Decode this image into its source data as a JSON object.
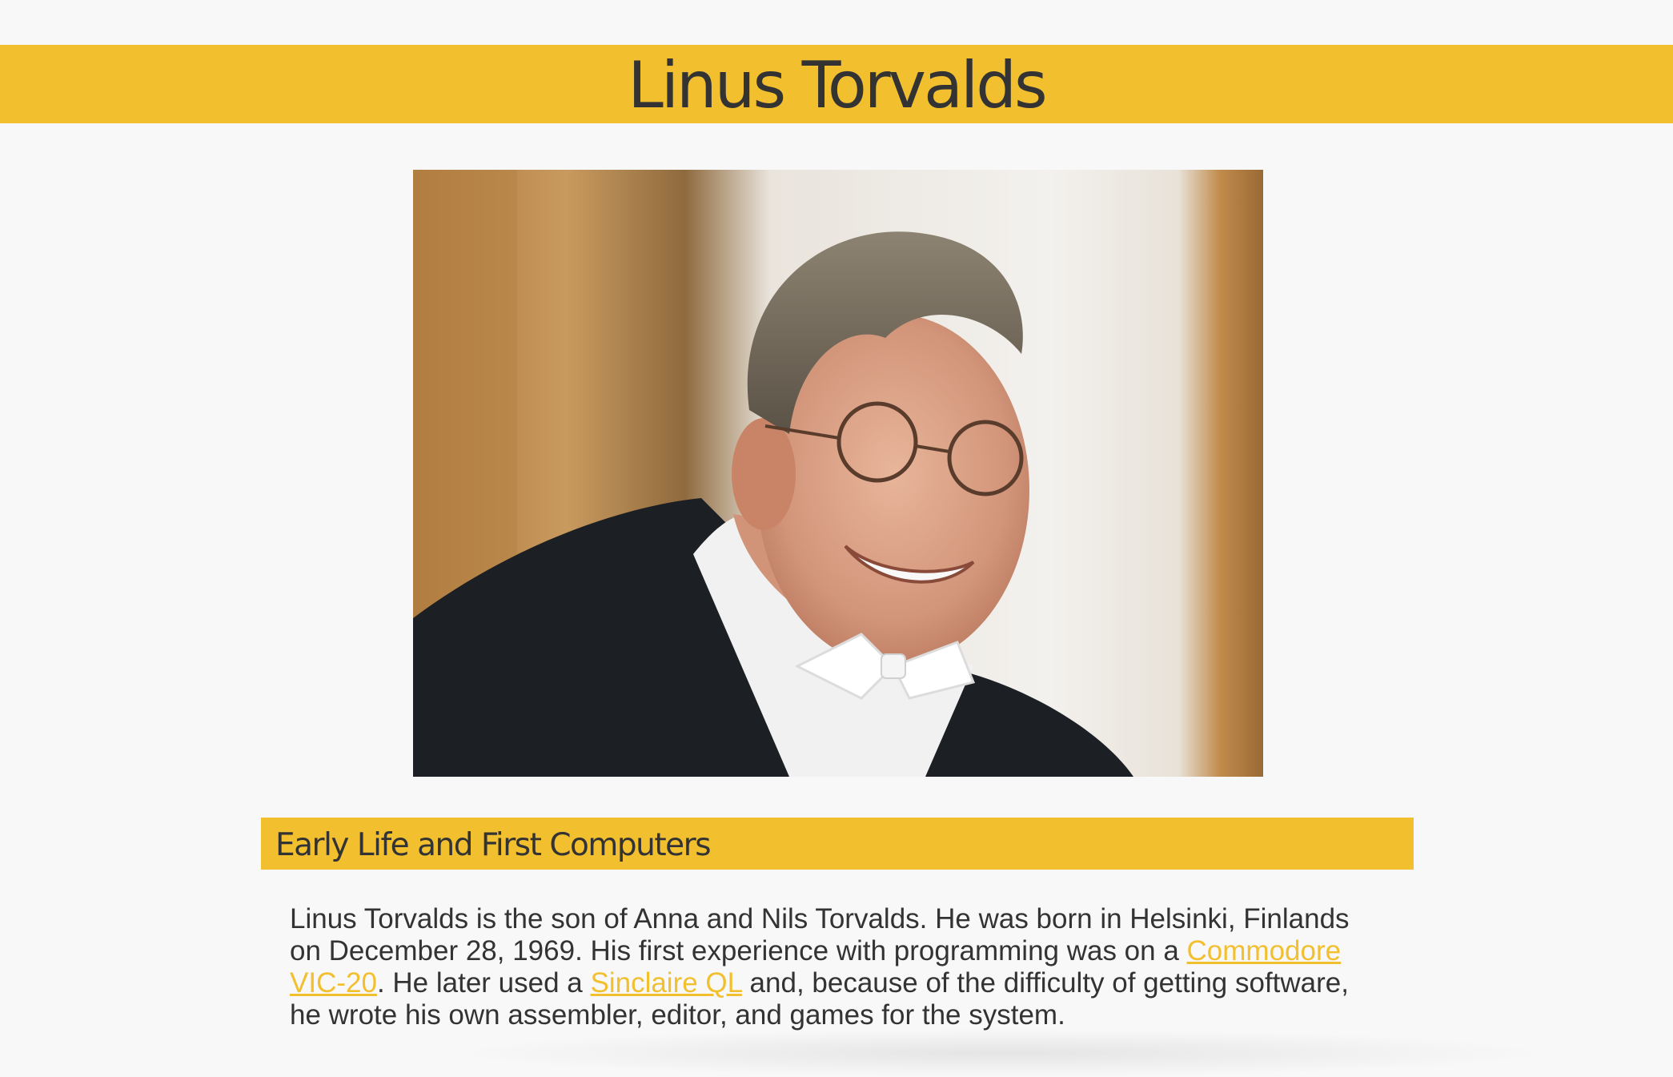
{
  "header": {
    "title": "Linus Torvalds"
  },
  "portrait": {
    "subject": "Smiling man with glasses wearing a black tuxedo and white bow tie",
    "icon": "portrait-photo"
  },
  "section": {
    "heading": "Early Life and First Computers",
    "bio": {
      "part1": "Linus Torvalds is the son of Anna and Nils Torvalds. He was born in Helsinki, Finlands on December 28, 1969. His first experience with programming was on a ",
      "link1": "Commodore VIC-20",
      "part2": ". He later used a ",
      "link2": "Sinclaire QL",
      "part3": " and, because of the difficulty of getting software, he wrote his own assembler, editor, and games for the system."
    }
  },
  "colors": {
    "accent": "#f2bf2f",
    "text": "#333333",
    "background": "#f8f8f8"
  }
}
